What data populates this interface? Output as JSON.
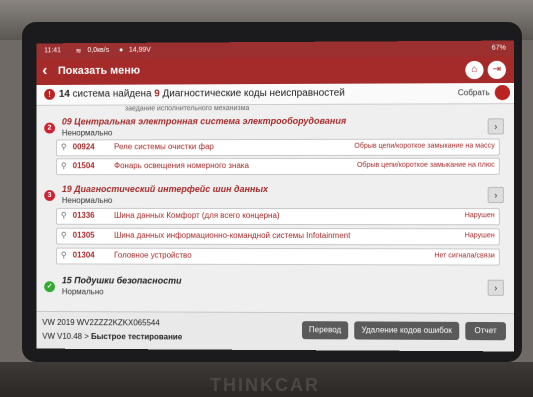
{
  "status_bar": {
    "time": "11:41",
    "net_speed": "0,0кв/s",
    "voltage": "14,99V",
    "battery": "67%"
  },
  "header": {
    "title": "Показать меню"
  },
  "summary": {
    "prefix": "14",
    "text1": "система найдена",
    "count": "9",
    "text2": "Диагностические коды неисправностей",
    "collect_label": "Собрать"
  },
  "cutoff_text": "заедание исполнительного механизма",
  "systems": [
    {
      "num": "2",
      "name": "09 Центральная электронная система электрооборудования",
      "status": "Ненормально",
      "dtcs": [
        {
          "code": "00924",
          "desc": "Реле системы очистки фар",
          "state": "Обрыв цепи/короткое замыкание на массу"
        },
        {
          "code": "01504",
          "desc": "Фонарь освещения номерного знака",
          "state": "Обрыв цепи/короткое замыкание на плюс"
        }
      ]
    },
    {
      "num": "3",
      "name": "19 Диагностический интерфейс шин данных",
      "status": "Ненормально",
      "dtcs": [
        {
          "code": "01336",
          "desc": "Шина данных Комфорт (для всего концерна)",
          "state": "Нарушен"
        },
        {
          "code": "01305",
          "desc": "Шина данных информационно-командной системы Infotainment",
          "state": "Нарушен"
        },
        {
          "code": "01304",
          "desc": "Головное устройство",
          "state": "Нет сигнала/связи"
        }
      ]
    },
    {
      "num": "✓",
      "name": "15 Подушки безопасности",
      "status": "Нормально",
      "dtcs": []
    }
  ],
  "footer": {
    "vin_line": "VW  2019  WV2ZZZ2KZKX065544",
    "version_prefix": "VW V10.48 >",
    "version_mode": "Быстрое тестирование",
    "buttons": {
      "translate": "Перевод",
      "clear_codes": "Удаление кодов ошибок",
      "report": "Отчет"
    }
  },
  "brand": "THINKCAR",
  "colors": {
    "header": "#a52a2a",
    "error_text": "#a52a2a",
    "ok_icon": "#33aa33"
  }
}
